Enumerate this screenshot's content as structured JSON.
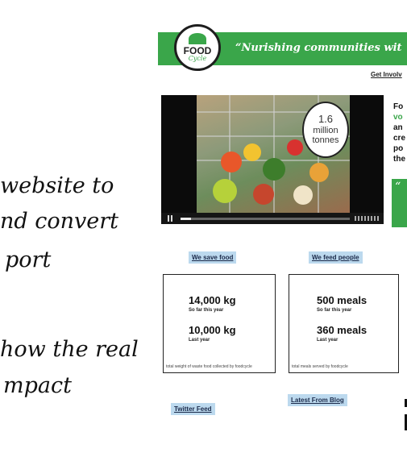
{
  "slide": {
    "line1": "website to",
    "line2": "nd convert",
    "line3": "port",
    "line4": "how the real",
    "line5": "mpact"
  },
  "site": {
    "logo_main": "FOOD",
    "logo_sub": "Cycle",
    "tagline": "“Nurishing communities wit",
    "nav_get_involved": "Get Involv",
    "video": {
      "bubble_number": "1.6",
      "bubble_line2": "million",
      "bubble_line3": "tonnes",
      "progress": 0.06
    },
    "intro": {
      "line1": "Fo",
      "line2": "vo",
      "line3": "an",
      "line4": "cre",
      "line5": "po",
      "line6": "the",
      "quote_mark": "“"
    },
    "save_food": {
      "header": "We save food",
      "value1": "14,000 kg",
      "label1": "So far this year",
      "value2": "10,000 kg",
      "label2": "Last year",
      "note": "total weight of waste food collected by foodcycle"
    },
    "feed_people": {
      "header": "We feed people",
      "value1": "500 meals",
      "label1": "So far this year",
      "value2": "360 meals",
      "label2": "Last year",
      "note": "total meals served by foodcycle"
    },
    "twitter_label": "Twitter Feed",
    "blog_label": "Latest From Blog"
  }
}
